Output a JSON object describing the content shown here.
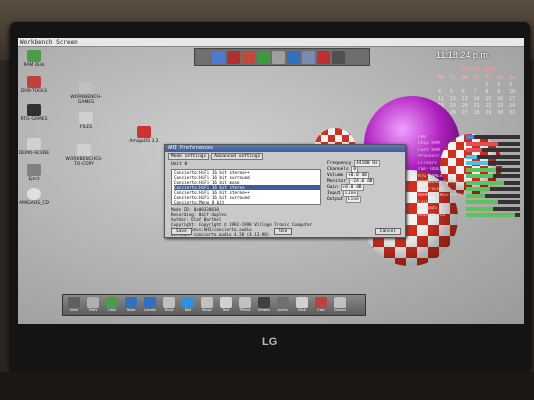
{
  "screen": {
    "title": "Workbench Screen",
    "clock": "11:18:24 p.m.",
    "calendar": {
      "month": "March 2024",
      "weekdays": [
        "Mo",
        "Tu",
        "We",
        "Th",
        "Fr",
        "Sa",
        "Su"
      ],
      "days": [
        "",
        "",
        "",
        "",
        "1",
        "2",
        "3",
        "4",
        "5",
        "6",
        "7",
        "8",
        "9",
        "10",
        "11",
        "12",
        "13",
        "14",
        "15",
        "16",
        "17",
        "18",
        "19",
        "20",
        "21",
        "22",
        "23",
        "24",
        "25",
        "26",
        "27",
        "28",
        "29",
        "30",
        "31"
      ]
    }
  },
  "desktop_icons": [
    {
      "label": "RAM Disk",
      "color": "#4a9b4a"
    },
    {
      "label": "DH0-TOOLS",
      "color": "#c04040"
    },
    {
      "label": "WORKBENCH-GAMES",
      "color": "#c0c0c0"
    },
    {
      "label": "RTG-GAMES",
      "color": "#303030"
    },
    {
      "label": "FILES",
      "color": "#d0d0d0"
    },
    {
      "label": "AmigaOS 3.2",
      "color": "#cc3333"
    },
    {
      "label": "DEMO-SCENE",
      "color": "#d0d0d0"
    },
    {
      "label": "WORKBENCHES-TO-COPY",
      "color": "#d0d0d0"
    },
    {
      "label": "Eject",
      "color": "#808080"
    },
    {
      "label": "AMIGAOS_CD",
      "color": "#e0e0e0"
    }
  ],
  "sysmon": [
    {
      "label": "CPU",
      "fill": 0.15,
      "color": "#5a78e0"
    },
    {
      "label": "Chip RAM",
      "fill": 0.6,
      "color": "#e05050"
    },
    {
      "label": "Fast RAM",
      "fill": 0.3,
      "color": "#e05050"
    },
    {
      "label": "Processr",
      "fill": 0.2,
      "color": "#50c0e0"
    },
    {
      "label": "Cr/ears",
      "fill": 0.4,
      "color": "#50c0e0"
    },
    {
      "label": "ram-TOOLS",
      "fill": 0.55,
      "color": "#60c060"
    },
    {
      "label": "RTG-GAMES",
      "fill": 0.5,
      "color": "#60c060"
    },
    {
      "label": "WORKBENCH-GAMES",
      "fill": 0.7,
      "color": "#60c060"
    },
    {
      "label": "DEMO-SCENE",
      "fill": 0.45,
      "color": "#60c060"
    },
    {
      "label": "WORKBENCHES-TO-COPY",
      "fill": 0.35,
      "color": "#60c060"
    },
    {
      "label": "FILES",
      "fill": 0.6,
      "color": "#60c060"
    },
    {
      "label": "AmigaOS 3.2",
      "fill": 0.5,
      "color": "#60c060"
    },
    {
      "label": "AMIGAOS_CD",
      "fill": 0.9,
      "color": "#60c060"
    }
  ],
  "window": {
    "title": "AHI Preferences",
    "tabs": [
      "Mode settings",
      "Advanced settings"
    ],
    "unit_label": "Unit 0",
    "modes": [
      "Concierto:HiFi 16 bit stereo++",
      "Concierto:HiFi 16 bit surround",
      "Concierto:HiFi 16 bit mono",
      "Concierto:HiFi 16 bit stereo",
      "Concierto:HiFi 16 bit stereo++",
      "Concierto:HiFi 16 bit surround",
      "Concierto:Mono 8 bit",
      "Concierto:Stereo 8 bit",
      "Concierto:Stereo++ 8 bit"
    ],
    "selected_index": 3,
    "options": [
      {
        "label": "Frequency",
        "value": "44100 Hz"
      },
      {
        "label": "Channels",
        "value": "8"
      },
      {
        "label": "Volume",
        "value": "+0.0 dB"
      },
      {
        "label": "Monitor",
        "value": "-24.0 dB"
      },
      {
        "label": "Gain",
        "value": "+0.0 dB"
      },
      {
        "label": "Input",
        "value": "Line"
      },
      {
        "label": "Output",
        "value": "Line"
      }
    ],
    "info": [
      "Mode ID: 0x00330010",
      "Recording: Half duplex",
      "Author: Olaf Barthel",
      "Copyright: Copyright © 1992-1998 Village Tronic Computer",
      "Driver: Devs:AHI/concierto.audio",
      "Version: concierto.audio 4.28 (4.13.98)"
    ],
    "buttons": {
      "save": "Save",
      "use": "Use",
      "cancel": "Cancel"
    }
  },
  "dock": [
    {
      "label": "Shell",
      "color": "#606060"
    },
    {
      "label": "Prefs",
      "color": "#b0b0b0"
    },
    {
      "label": "Utils",
      "color": "#4a9b4a"
    },
    {
      "label": "Tools",
      "color": "#3070c0"
    },
    {
      "label": "Locale",
      "color": "#3070c0"
    },
    {
      "label": "Paint",
      "color": "#c0c0c0"
    },
    {
      "label": "Net",
      "color": "#3090e0"
    },
    {
      "label": "Music",
      "color": "#c0c0c0"
    },
    {
      "label": "Text",
      "color": "#d0d0d0"
    },
    {
      "label": "PPaint",
      "color": "#c0c0c0"
    },
    {
      "label": "Viewer",
      "color": "#404040"
    },
    {
      "label": "Archiv",
      "color": "#707070"
    },
    {
      "label": "Disk",
      "color": "#d0d0d0"
    },
    {
      "label": "Calc",
      "color": "#c04040"
    },
    {
      "label": "Games",
      "color": "#c0c0c0"
    }
  ],
  "monitor_logo": "LG"
}
